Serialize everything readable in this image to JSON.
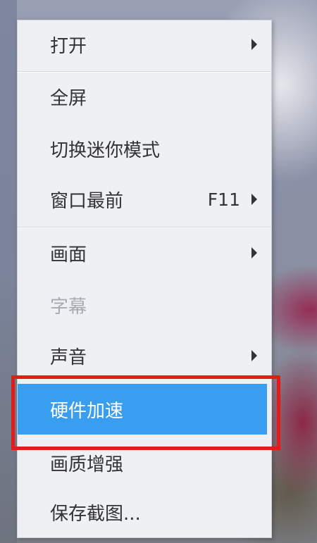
{
  "context_menu": {
    "items": [
      {
        "label": "打开",
        "has_submenu": true,
        "shortcut": ""
      },
      {
        "label": "全屏",
        "has_submenu": false,
        "shortcut": ""
      },
      {
        "label": "切换迷你模式",
        "has_submenu": false,
        "shortcut": ""
      },
      {
        "label": "窗口最前",
        "has_submenu": true,
        "shortcut": "F11"
      },
      {
        "label": "画面",
        "has_submenu": true,
        "shortcut": ""
      },
      {
        "label": "字幕",
        "has_submenu": false,
        "shortcut": "",
        "disabled": true
      },
      {
        "label": "声音",
        "has_submenu": true,
        "shortcut": ""
      },
      {
        "label": "硬件加速",
        "has_submenu": false,
        "shortcut": "",
        "highlighted": true
      },
      {
        "label": "画质增强",
        "has_submenu": false,
        "shortcut": ""
      },
      {
        "label": "保存截图...",
        "has_submenu": false,
        "shortcut": ""
      }
    ]
  },
  "colors": {
    "highlight": "#3a9ef0",
    "annotation_box": "#e31b1b",
    "menu_background": "#eef0f3",
    "disabled_text": "#a7abb2"
  },
  "icons": {
    "submenu_arrow": "chevron-right-icon"
  }
}
